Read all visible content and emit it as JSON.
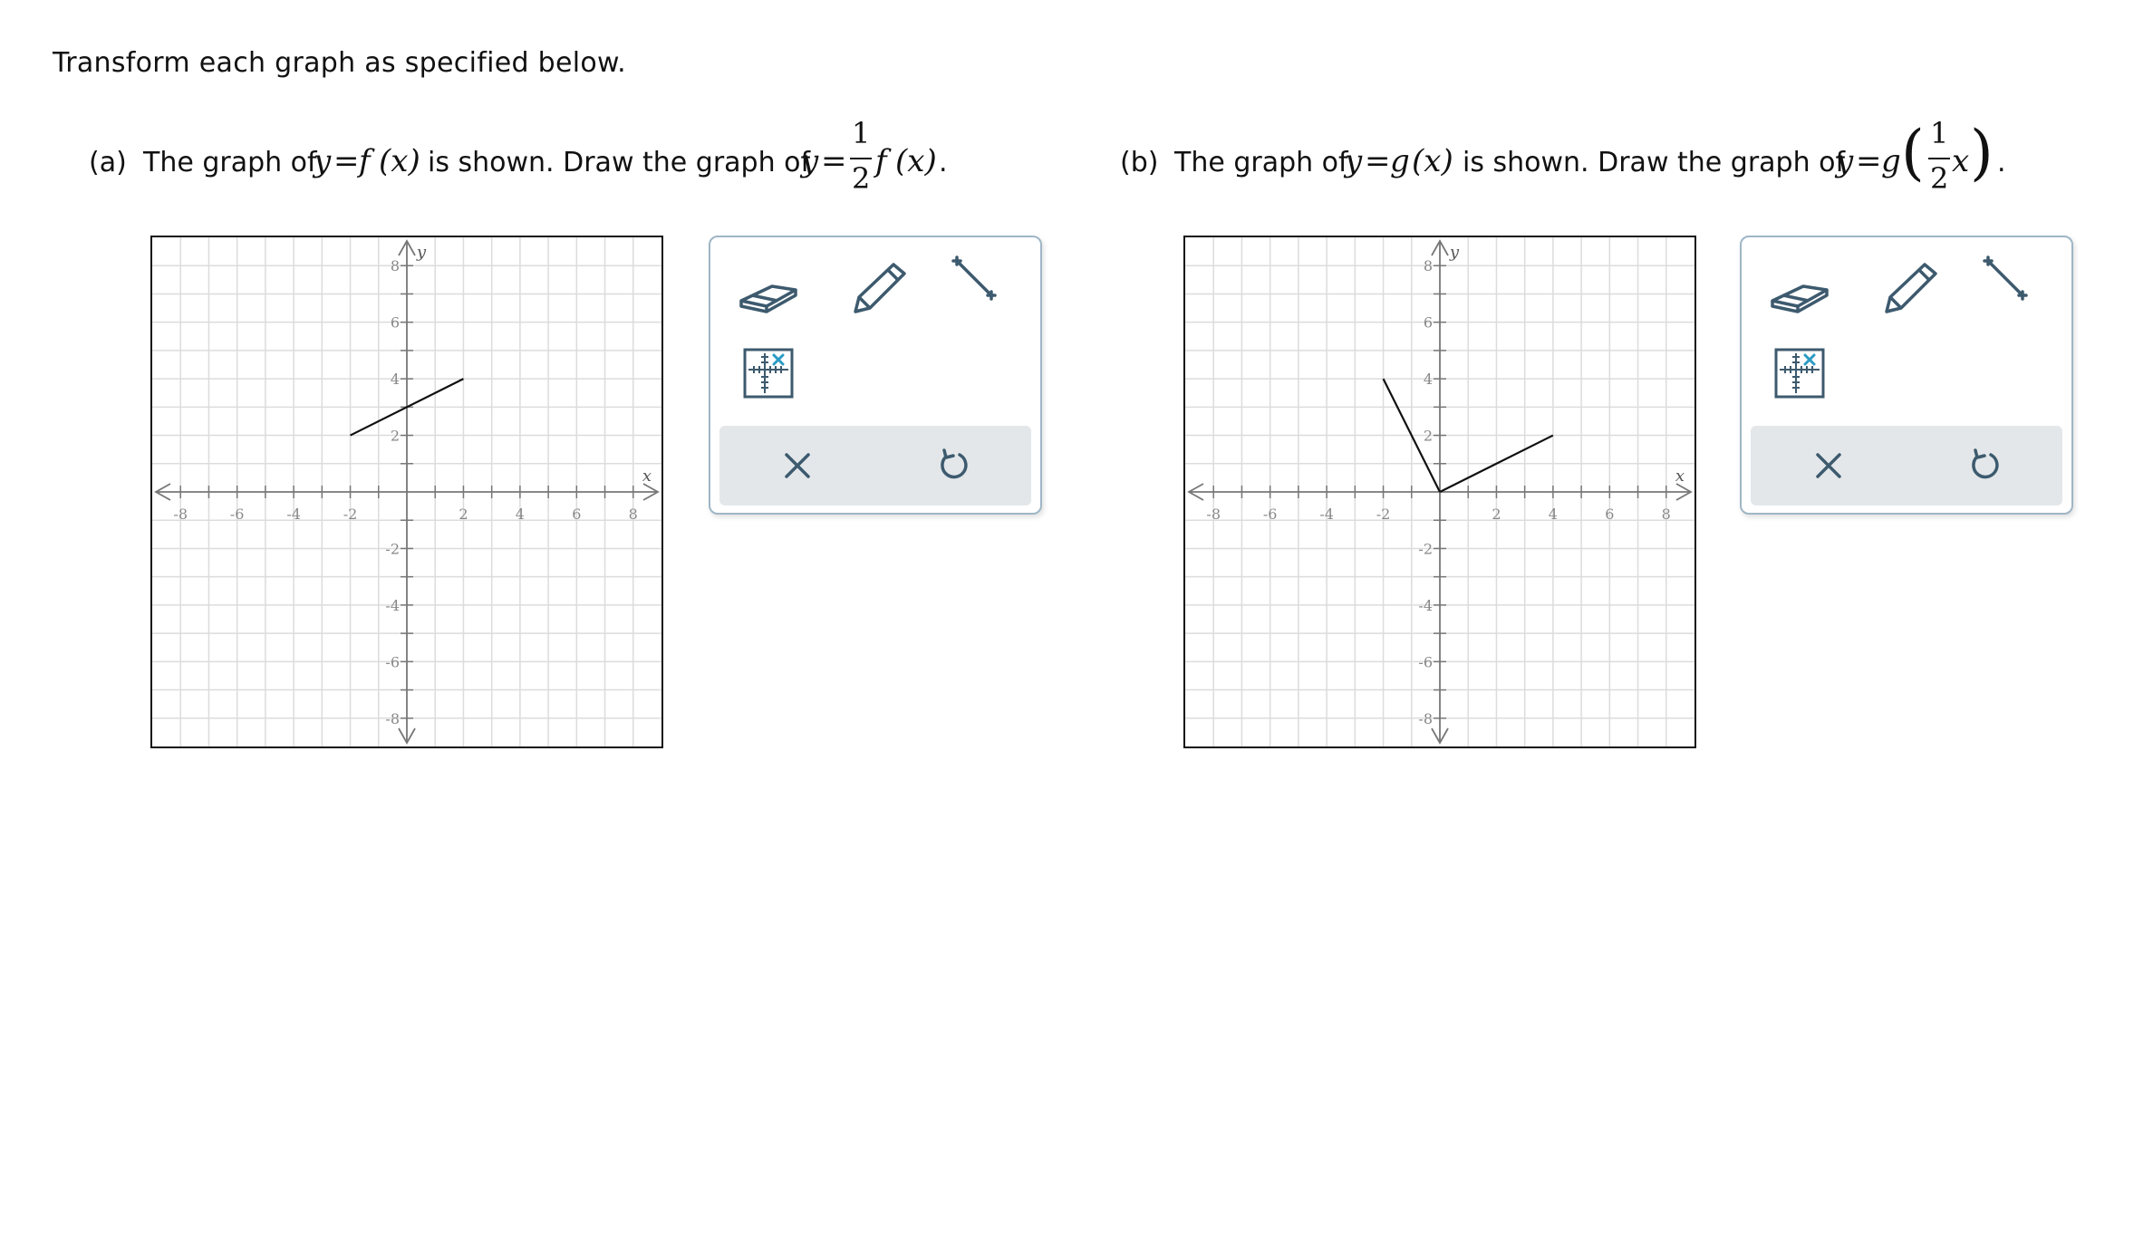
{
  "instructions": "Transform each graph as specified below.",
  "problems": [
    {
      "label": "(a)",
      "text_before": "The graph of",
      "shown_eq_lhs": "y",
      "shown_eq_eq": "=",
      "shown_eq_rhs": "f",
      "shown_eq_arg": "(x)",
      "text_middle": "is shown. Draw the graph of",
      "target_eq_lhs": "y",
      "target_eq_eq": "=",
      "frac_num": "1",
      "frac_den": "2",
      "target_eq_rhs": "f",
      "target_eq_arg": "(x)",
      "end_punct": ".",
      "x_axis_label": "x",
      "y_axis_label": "y",
      "x_tick_labels": [
        "-8",
        "-6",
        "-4",
        "-2",
        "2",
        "4",
        "6",
        "8"
      ],
      "y_tick_labels": [
        "8",
        "6",
        "4",
        "2",
        "-2",
        "-4",
        "-6",
        "-8"
      ],
      "segments": [
        {
          "from": [
            -2,
            2
          ],
          "to": [
            2,
            4
          ]
        }
      ]
    },
    {
      "label": "(b)",
      "text_before": "The graph of",
      "shown_eq_lhs": "y",
      "shown_eq_eq": "=",
      "shown_eq_rhs": "g",
      "shown_eq_arg": "(x)",
      "text_middle": "is shown. Draw the graph of",
      "target_eq_lhs": "y",
      "target_eq_eq": "=",
      "target_eq_rhs": "g",
      "paren_open": "(",
      "frac_num": "1",
      "frac_den": "2",
      "inner_var": "x",
      "paren_close": ")",
      "end_punct": ".",
      "x_axis_label": "x",
      "y_axis_label": "y",
      "x_tick_labels": [
        "-8",
        "-6",
        "-4",
        "-2",
        "2",
        "4",
        "6",
        "8"
      ],
      "y_tick_labels": [
        "8",
        "6",
        "4",
        "2",
        "-2",
        "-4",
        "-6",
        "-8"
      ],
      "segments": [
        {
          "from": [
            -2,
            4
          ],
          "to": [
            0,
            0
          ]
        },
        {
          "from": [
            0,
            0
          ],
          "to": [
            4,
            2
          ]
        }
      ]
    }
  ],
  "graph_settings": {
    "xlim": [
      -9,
      9
    ],
    "ylim": [
      -9,
      9
    ],
    "grid_step": 1,
    "tick_label_step": 2
  },
  "toolbar": {
    "tools": [
      "eraser-icon",
      "pencil-icon",
      "line-segment-icon",
      "point-grid-icon"
    ],
    "actions": [
      "clear-icon",
      "undo-icon"
    ],
    "icon_color": "#3d5a6e",
    "accent_color": "#2a9bc4"
  }
}
